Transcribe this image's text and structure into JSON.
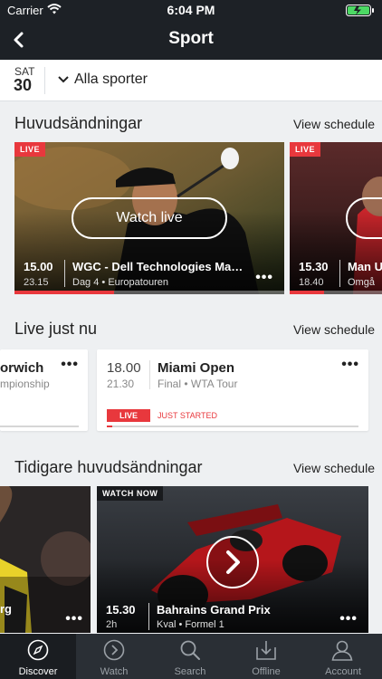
{
  "status": {
    "carrier": "Carrier",
    "time": "6:04 PM"
  },
  "nav": {
    "title": "Sport"
  },
  "datebar": {
    "dow": "SAT",
    "day": "30",
    "filter": "Alla sporter"
  },
  "featured": {
    "heading": "Huvudsändningar",
    "link": "View schedule",
    "cards": [
      {
        "tag": "LIVE",
        "button": "Watch live",
        "start": "15.00",
        "end": "23.15",
        "title": "WGC - Dell Technologies Ma…",
        "subtitle": "Dag 4 • Europatouren",
        "progress": 0.37
      },
      {
        "tag": "LIVE",
        "start": "15.30",
        "end": "18.40",
        "title": "Man U",
        "subtitle": "Omgå"
      }
    ]
  },
  "live": {
    "heading": "Live just nu",
    "link": "View schedule",
    "cards": [
      {
        "title": "orwich",
        "subtitle": "mpionship"
      },
      {
        "start": "18.00",
        "end": "21.30",
        "title": "Miami Open",
        "subtitle": "Final • WTA Tour",
        "badge": "LIVE",
        "status": "JUST STARTED"
      }
    ]
  },
  "earlier": {
    "heading": "Tidigare huvudsändningar",
    "link": "View schedule",
    "tiles": [
      {
        "title": "rg"
      },
      {
        "tag": "WATCH NOW",
        "start": "15.30",
        "duration": "2h",
        "title": "Bahrains Grand Prix",
        "subtitle": "Kval • Formel 1"
      }
    ]
  },
  "tabs": [
    {
      "label": "Discover",
      "icon": "compass-icon",
      "active": true
    },
    {
      "label": "Watch",
      "icon": "play-circle-icon",
      "active": false
    },
    {
      "label": "Search",
      "icon": "search-icon",
      "active": false
    },
    {
      "label": "Offline",
      "icon": "download-icon",
      "active": false
    },
    {
      "label": "Account",
      "icon": "user-icon",
      "active": false
    }
  ],
  "colors": {
    "accent": "#e8383d",
    "navbar": "#1d2126",
    "tabbar": "#2a2f35"
  }
}
